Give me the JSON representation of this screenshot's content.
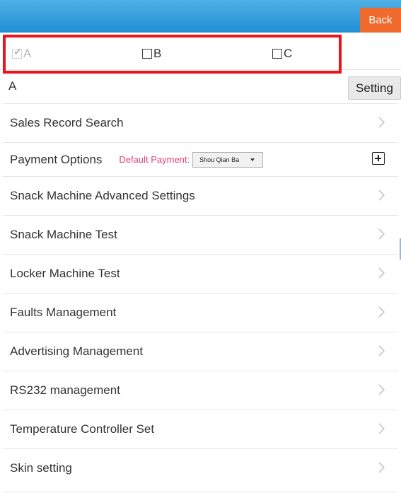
{
  "header": {
    "back_label": "Back"
  },
  "checks": [
    {
      "label": "A",
      "checked": true,
      "disabled": true
    },
    {
      "label": "B",
      "checked": false,
      "disabled": false
    },
    {
      "label": "C",
      "checked": false,
      "disabled": false
    }
  ],
  "selected_row": {
    "label": "A",
    "setting_label": "Setting"
  },
  "payment": {
    "label": "Payment Options",
    "default_label": "Default Payment:",
    "selected_value": "Shou Qian Ba"
  },
  "menu": [
    "Sales Record Search",
    "Snack Machine Advanced Settings",
    "Snack Machine Test",
    "Locker Machine Test",
    "Faults Management",
    "Advertising Management",
    "RS232 management",
    "Temperature Controller Set",
    "Skin setting"
  ],
  "colors": {
    "header": "#1f8ed3",
    "back_button": "#ef6a2c",
    "highlight_frame": "#e8131b",
    "default_payment_text": "#e0457b"
  }
}
